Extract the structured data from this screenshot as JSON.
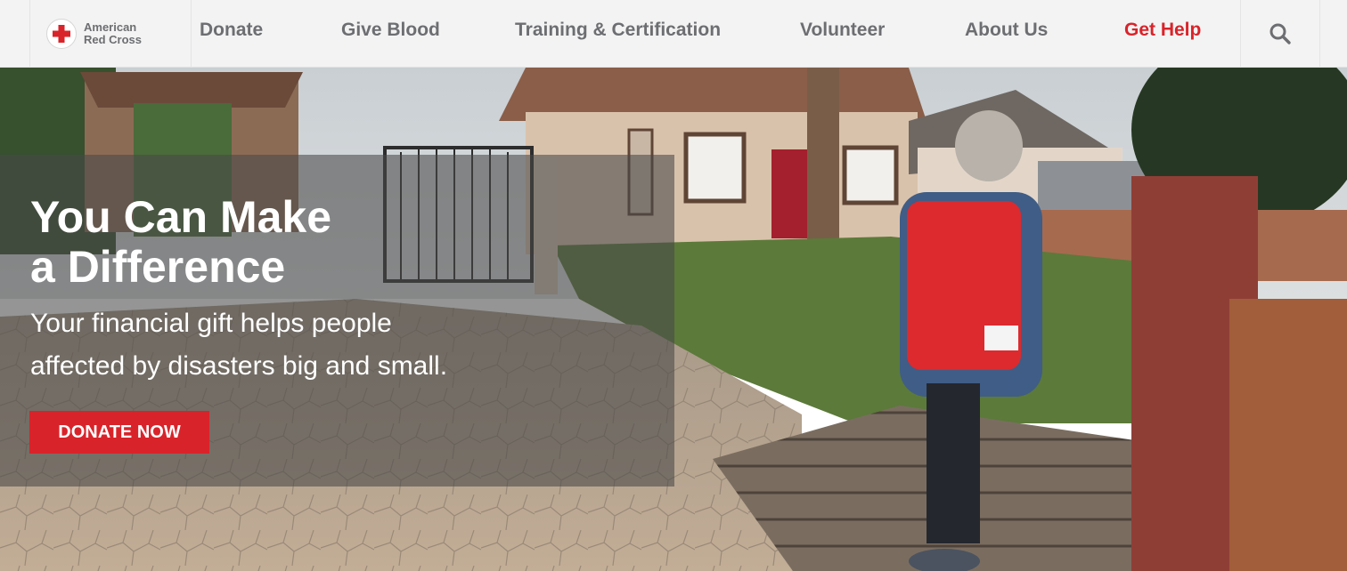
{
  "brand": {
    "line1": "American",
    "line2": "Red Cross",
    "accent_color": "#d9232a",
    "nav_text_color": "#6d6e71"
  },
  "nav": {
    "items": [
      {
        "label": "Donate"
      },
      {
        "label": "Give Blood"
      },
      {
        "label": "Training & Certification"
      },
      {
        "label": "Volunteer"
      },
      {
        "label": "About Us"
      },
      {
        "label": "Get Help"
      }
    ],
    "search_icon": "search-icon"
  },
  "hero": {
    "headline_line1": "You Can Make",
    "headline_line2": "a Difference",
    "subhead_line1": "Your financial gift helps people",
    "subhead_line2": "affected by disasters big and small.",
    "cta_label": "DONATE NOW",
    "image": "Red Cross volunteer in red vest surveying flood-damaged homes and mud-covered street"
  }
}
